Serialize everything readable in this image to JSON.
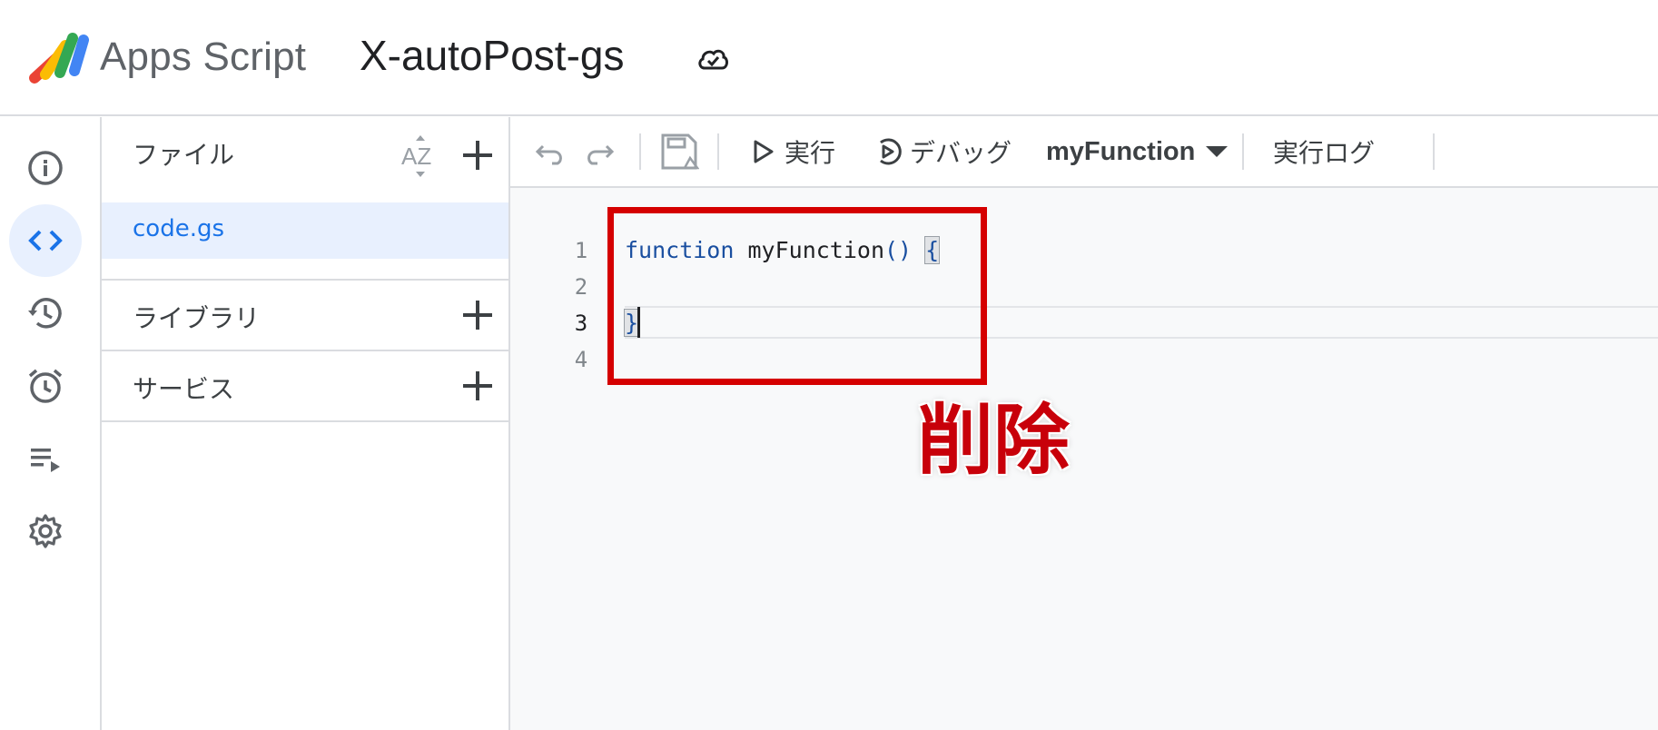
{
  "header": {
    "app_name": "Apps Script",
    "project_name": "X-autoPost-gs"
  },
  "rail": {
    "items": [
      {
        "name": "overview",
        "icon": "info-icon",
        "active": false
      },
      {
        "name": "editor",
        "icon": "code-icon",
        "active": true
      },
      {
        "name": "history",
        "icon": "history-icon",
        "active": false
      },
      {
        "name": "triggers",
        "icon": "alarm-icon",
        "active": false
      },
      {
        "name": "executions",
        "icon": "playlist-icon",
        "active": false
      },
      {
        "name": "settings",
        "icon": "gear-icon",
        "active": false
      }
    ]
  },
  "files_panel": {
    "files_title": "ファイル",
    "files": [
      {
        "name": "code.gs",
        "selected": true
      }
    ],
    "libraries_title": "ライブラリ",
    "services_title": "サービス"
  },
  "toolbar": {
    "run_label": "実行",
    "debug_label": "デバッグ",
    "function_selected": "myFunction",
    "log_label": "実行ログ"
  },
  "editor": {
    "line_numbers": [
      "1",
      "2",
      "3",
      "4"
    ],
    "code": {
      "keyword": "function",
      "name": "myFunction",
      "parens": "()",
      "open_brace": "{",
      "close_brace": "}"
    }
  },
  "annotation": {
    "label": "削除",
    "color": "#d50000"
  },
  "colors": {
    "accent": "#1a73e8",
    "active_bg": "#e8f0fe",
    "editor_bg": "#f8f9fa",
    "annotation_red": "#d50000"
  }
}
